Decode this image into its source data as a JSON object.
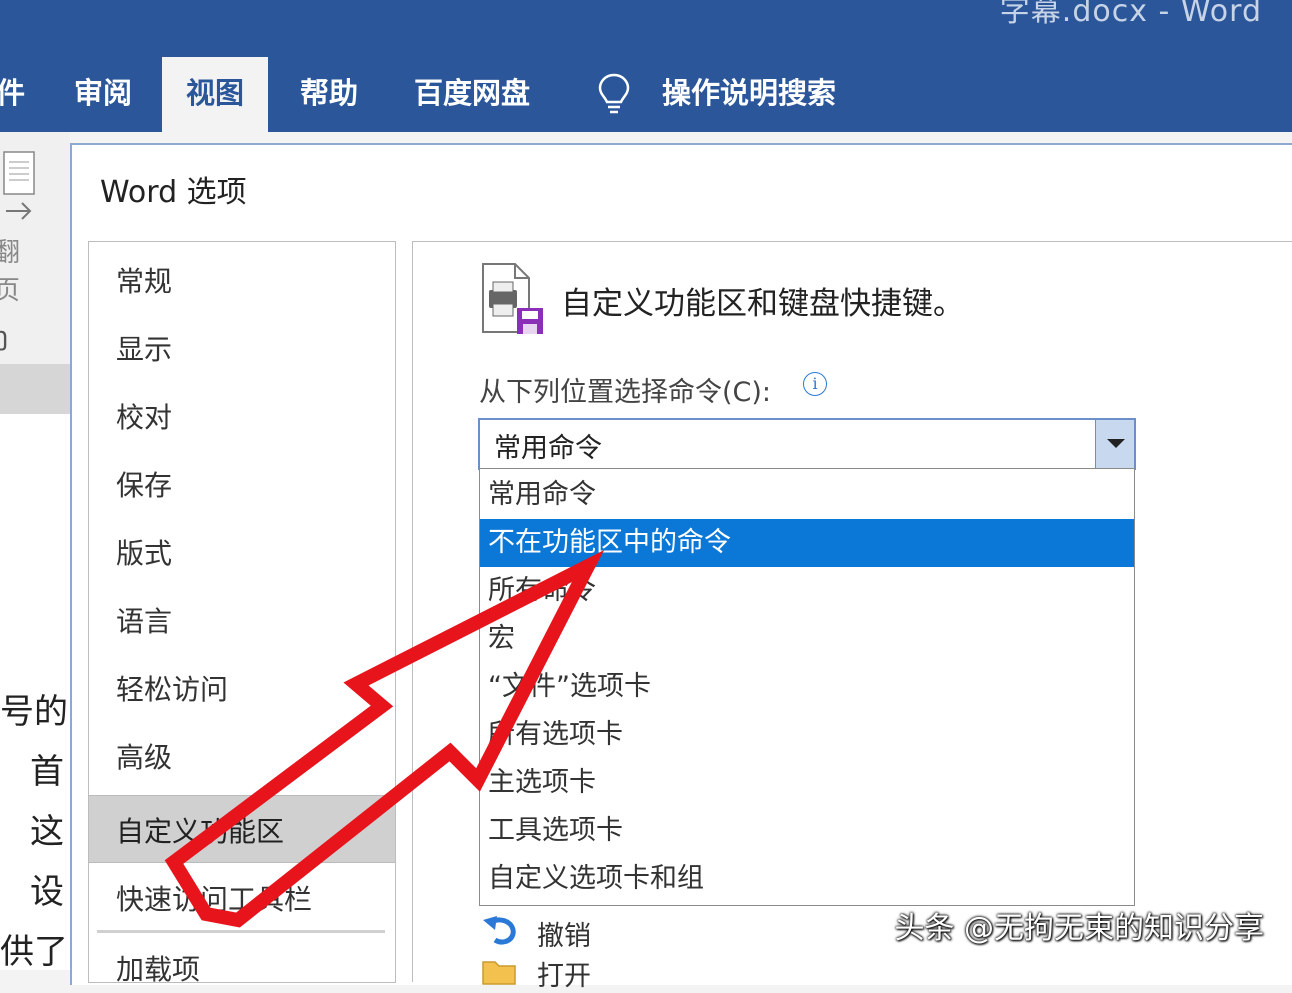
{
  "window": {
    "title": "字幕.docx  -  Word"
  },
  "ribbon": {
    "tabs": [
      {
        "label": "件",
        "active": false
      },
      {
        "label": "审阅",
        "active": false
      },
      {
        "label": "视图",
        "active": true
      },
      {
        "label": "帮助",
        "active": false
      },
      {
        "label": "百度网盘",
        "active": false
      },
      {
        "label": "操作说明搜索",
        "active": false
      }
    ]
  },
  "leftstrip": {
    "top": [
      "翻",
      "页",
      "ŋ"
    ],
    "doc_fragments": [
      "号的",
      "首",
      "这",
      "设",
      "供了"
    ]
  },
  "dialog": {
    "title": "Word 选项",
    "nav": [
      "常规",
      "显示",
      "校对",
      "保存",
      "版式",
      "语言",
      "轻松访问",
      "高级",
      "自定义功能区",
      "快速访问工具栏",
      "加载项"
    ],
    "selected_nav": "自定义功能区",
    "heading": "自定义功能区和键盘快捷键。",
    "choose_label": "从下列位置选择命令(C):",
    "info_glyph": "i",
    "combo_value": "常用命令",
    "dropdown_options": [
      "常用命令",
      "不在功能区中的命令",
      "所有命令",
      "宏",
      "“文件”选项卡",
      "所有选项卡",
      "主选项卡",
      "工具选项卡",
      "自定义选项卡和组"
    ],
    "selected_option": "不在功能区中的命令",
    "commands": [
      "撤销",
      "打开"
    ]
  },
  "watermark": "头条 @无拘无束的知识分享",
  "colors": {
    "ribbon": "#2b579a",
    "selection": "#0b78d7",
    "arrow": "#e8141c"
  }
}
